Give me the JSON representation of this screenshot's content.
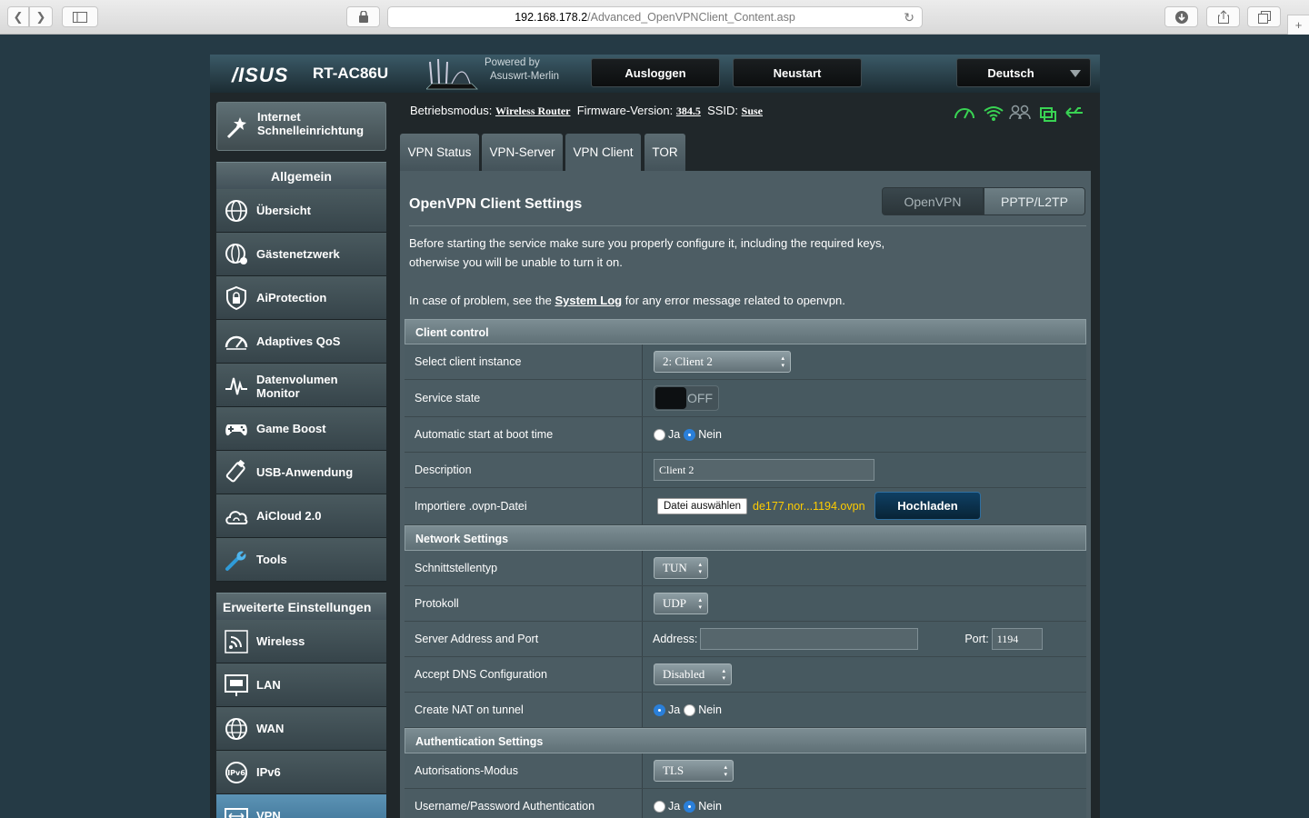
{
  "browser": {
    "url_host": "192.168.178.2",
    "url_path": "/Advanced_OpenVPNClient_Content.asp"
  },
  "header": {
    "brand": "/ISUS",
    "model": "RT-AC86U",
    "powered_line1": "Powered by",
    "powered_line2": "Asuswrt-Merlin",
    "logout": "Ausloggen",
    "reboot": "Neustart",
    "language": "Deutsch"
  },
  "status": {
    "mode_label": "Betriebsmodus:",
    "mode_value": "Wireless Router",
    "fw_label": "Firmware-Version:",
    "fw_value": "384.5",
    "ssid_label": "SSID:",
    "ssid_value": "Suse"
  },
  "sidebar": {
    "qis_line1": "Internet",
    "qis_line2": "Schnelleinrichtung",
    "general_header": "Allgemein",
    "general_items": [
      {
        "label": "Übersicht"
      },
      {
        "label": "Gästenetzwerk"
      },
      {
        "label": "AiProtection"
      },
      {
        "label": "Adaptives QoS"
      },
      {
        "label1": "Datenvolumen",
        "label2": "Monitor"
      },
      {
        "label": "Game Boost"
      },
      {
        "label": "USB-Anwendung"
      },
      {
        "label": "AiCloud 2.0"
      },
      {
        "label": "Tools"
      }
    ],
    "advanced_header": "Erweiterte Einstellungen",
    "advanced_items": [
      {
        "label": "Wireless"
      },
      {
        "label": "LAN"
      },
      {
        "label": "WAN"
      },
      {
        "label": "IPv6"
      },
      {
        "label": "VPN"
      }
    ]
  },
  "tabs": [
    "VPN Status",
    "VPN-Server",
    "VPN Client",
    "TOR"
  ],
  "content": {
    "title": "OpenVPN Client Settings",
    "seg_openvpn": "OpenVPN",
    "seg_pptp": "PPTP/L2TP",
    "desc_line1": "Before starting the service make sure you properly configure it, including the required keys,",
    "desc_line2": "otherwise you will be unable to turn it on.",
    "desc_line3_pre": "In case of problem, see the",
    "desc_link": "System Log",
    "desc_line3_post": "for any error message related to openvpn."
  },
  "client_control": {
    "header": "Client control",
    "instance_label": "Select client instance",
    "instance_value": "2: Client 2",
    "service_label": "Service state",
    "service_value": "OFF",
    "autostart_label": "Automatic start at boot time",
    "description_label": "Description",
    "description_value": "Client 2",
    "import_label": "Importiere .ovpn-Datei",
    "file_button": "Datei auswählen",
    "file_name": "de177.nor...1194.ovpn",
    "upload_button": "Hochladen"
  },
  "network": {
    "header": "Network Settings",
    "iface_label": "Schnittstellentyp",
    "iface_value": "TUN",
    "proto_label": "Protokoll",
    "proto_value": "UDP",
    "server_label": "Server Address and Port",
    "address_label": "Address:",
    "port_label": "Port:",
    "port_value": "1194",
    "dns_label": "Accept DNS Configuration",
    "dns_value": "Disabled",
    "nat_label": "Create NAT on tunnel"
  },
  "auth": {
    "header": "Authentication Settings",
    "mode_label": "Autorisations-Modus",
    "mode_value": "TLS",
    "userpass_label": "Username/Password Authentication"
  },
  "radio": {
    "yes": "Ja",
    "no": "Nein"
  },
  "colors": {
    "accent_yellow": "#ffcc00",
    "status_green": "#39d353",
    "active_blue": "#386d90"
  }
}
